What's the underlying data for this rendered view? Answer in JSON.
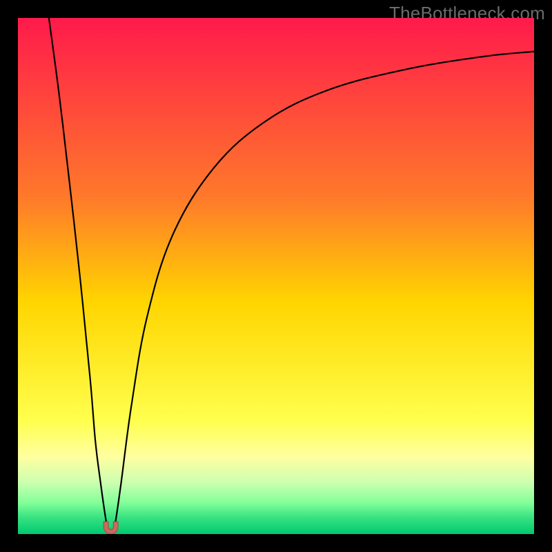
{
  "watermark": "TheBottleneck.com",
  "chart_data": {
    "type": "line",
    "title": "",
    "xlabel": "",
    "ylabel": "",
    "xlim": [
      0,
      100
    ],
    "ylim": [
      0,
      100
    ],
    "notch_x": 18,
    "background": {
      "stops": [
        {
          "y_pct": 0,
          "color": "#ff1a4b"
        },
        {
          "y_pct": 35,
          "color": "#ff7a2a"
        },
        {
          "y_pct": 55,
          "color": "#ffd500"
        },
        {
          "y_pct": 78,
          "color": "#ffff4d"
        },
        {
          "y_pct": 85,
          "color": "#ffffa0"
        },
        {
          "y_pct": 90,
          "color": "#ccffb0"
        },
        {
          "y_pct": 94,
          "color": "#80ff99"
        },
        {
          "y_pct": 97,
          "color": "#33e080"
        },
        {
          "y_pct": 100,
          "color": "#00c96f"
        }
      ]
    },
    "series": [
      {
        "name": "left-branch",
        "x": [
          6,
          8,
          10,
          12,
          14,
          15,
          16,
          17,
          17.5
        ],
        "y": [
          100,
          85,
          68,
          50,
          30,
          18,
          10,
          3,
          0.5
        ]
      },
      {
        "name": "right-branch",
        "x": [
          18.5,
          19,
          20,
          22,
          25,
          30,
          38,
          48,
          60,
          75,
          90,
          100
        ],
        "y": [
          0.5,
          3,
          10,
          25,
          42,
          58,
          71,
          80,
          86,
          90,
          92.5,
          93.5
        ]
      }
    ],
    "marker": {
      "name": "u-marker",
      "x": 18,
      "y": 0.6,
      "color": "#c96a5e"
    }
  }
}
